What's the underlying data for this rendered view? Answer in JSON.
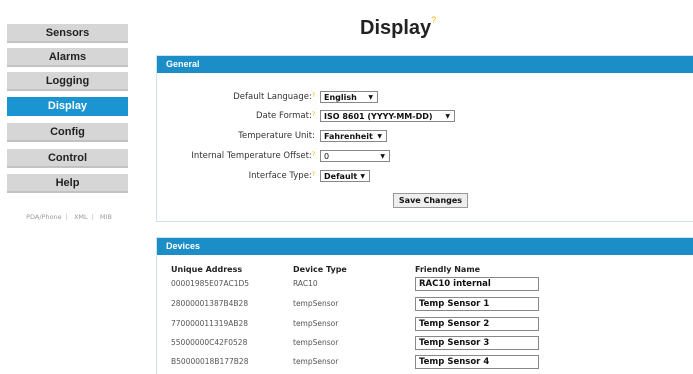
{
  "sidebar": {
    "items": [
      {
        "label": "Sensors",
        "active": false
      },
      {
        "label": "Alarms",
        "active": false
      },
      {
        "label": "Logging",
        "active": false
      },
      {
        "label": "Display",
        "active": true
      },
      {
        "label": "Config",
        "active": false
      },
      {
        "label": "Control",
        "active": false
      },
      {
        "label": "Help",
        "active": false
      }
    ],
    "footer_links": [
      "PDA/Phone",
      "XML",
      "MIB"
    ]
  },
  "page_title": "Display",
  "page_title_mark": "?",
  "general": {
    "title": "General",
    "language_label": "Default Language:",
    "language_value": "English",
    "date_format_label": "Date Format:",
    "date_format_value": "ISO 8601 (YYYY-MM-DD)",
    "temp_unit_label": "Temperature Unit:",
    "temp_unit_value": "Fahrenheit",
    "temp_offset_label": "Internal Temperature Offset:",
    "temp_offset_value": "0",
    "interface_label": "Interface Type:",
    "interface_value": "Default",
    "help_mark": "?",
    "save_label": "Save Changes"
  },
  "devices": {
    "title": "Devices",
    "columns": [
      "Unique Address",
      "Device Type",
      "Friendly Name"
    ],
    "rows": [
      {
        "address": "00001985E07AC1D5",
        "type": "RAC10",
        "name": "RAC10 internal"
      },
      {
        "address": "28000001387B4B28",
        "type": "tempSensor",
        "name": "Temp Sensor 1"
      },
      {
        "address": "770000011319AB28",
        "type": "tempSensor",
        "name": "Temp Sensor 2"
      },
      {
        "address": "55000000C42F0528",
        "type": "tempSensor",
        "name": "Temp Sensor 3"
      },
      {
        "address": "B50000018B177B28",
        "type": "tempSensor",
        "name": "Temp Sensor  4"
      }
    ]
  },
  "colors": {
    "accent": "#1b8ec7",
    "active_nav": "#1b95d1",
    "nav_bg": "#d6d6d6",
    "help_mark": "#f4b400"
  }
}
